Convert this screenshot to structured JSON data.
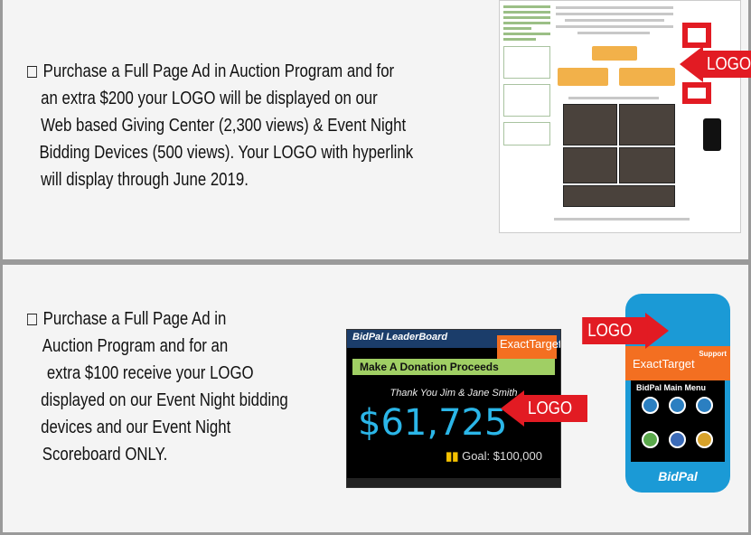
{
  "option1": {
    "lines": [
      "Purchase a Full Page Ad in Auction Program and for",
      "an extra $200 your LOGO will be displayed on our",
      "Web based Giving Center (2,300 views) & Event Night",
      "Bidding Devices (500 views). Your LOGO with hyperlink",
      "will display through June 2019."
    ],
    "logo_label": "LOGO"
  },
  "option2": {
    "lines": [
      "Purchase a Full Page Ad in",
      "Auction Program  and for an",
      "extra $100 receive your LOGO",
      "displayed on our Event Night bidding",
      "devices and our Event Night",
      "Scoreboard ONLY."
    ],
    "logo_label_board": "LOGO",
    "logo_label_phone": "LOGO"
  },
  "leaderboard": {
    "header": "BidPal LeaderBoard",
    "sponsor": "ExactTarget",
    "banner": "Make A Donation Proceeds",
    "thanks": "Thank You Jim & Jane Smith",
    "amount": "$61,725",
    "goal": "Goal: $100,000"
  },
  "phone": {
    "sponsor": "ExactTarget",
    "support": "Support",
    "menu_title": "BidPal  Main Menu",
    "brand": "BidPal"
  },
  "colors": {
    "accent_red": "#e21b23",
    "panel_border": "#9a9a9a",
    "green": "#7fb76a"
  }
}
